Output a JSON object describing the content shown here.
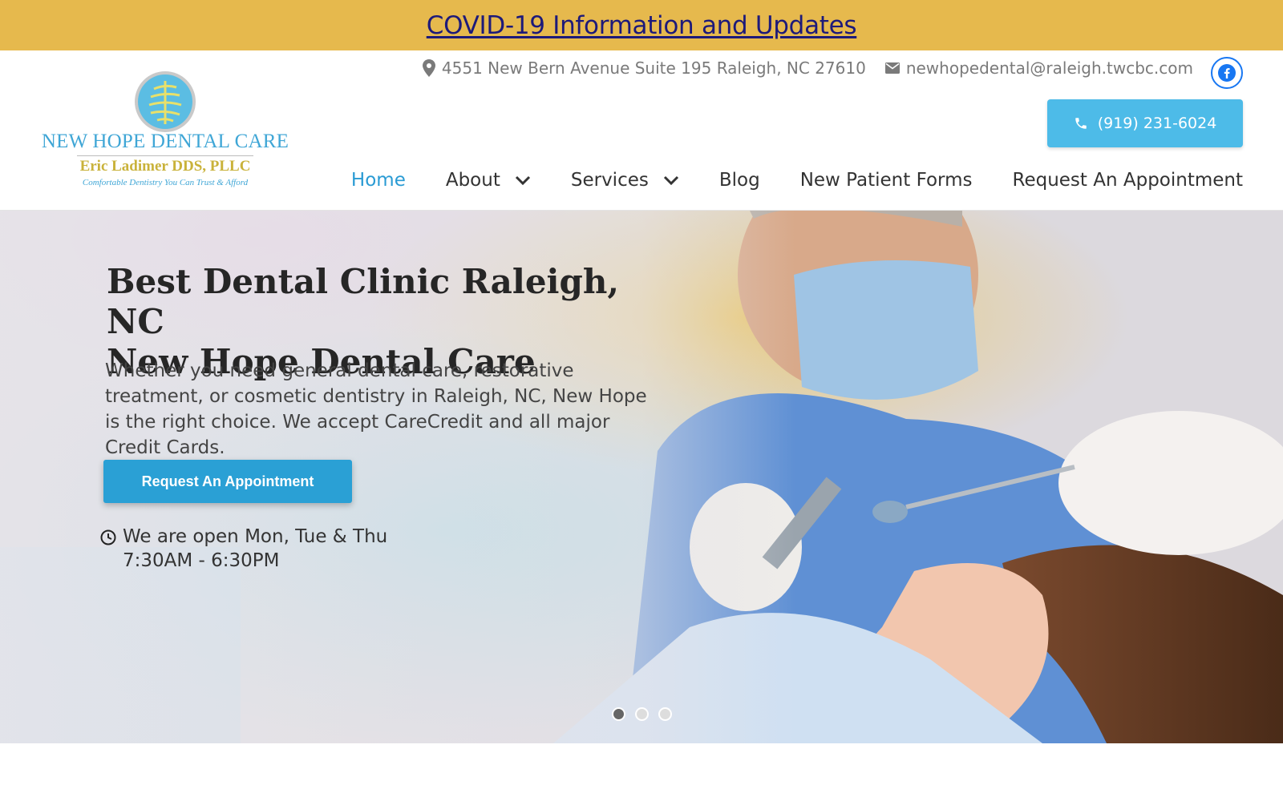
{
  "covid_banner": {
    "text": "COVID-19 Information and Updates",
    "bg_color": "#e6b94d",
    "link_color": "#1d1a7a"
  },
  "logo": {
    "title": "NEW HOPE DENTAL CARE",
    "subtitle": "Eric Ladimer DDS, PLLC",
    "tagline": "Comfortable Dentistry You Can Trust & Afford",
    "icon": "tree-emblem-icon"
  },
  "contact": {
    "address": "4551 New Bern Avenue Suite 195 Raleigh, NC 27610",
    "address_icon": "map-pin-icon",
    "email": "newhopedental@raleigh.twcbc.com",
    "email_icon": "envelope-icon",
    "social_icon": "facebook-icon",
    "phone": "(919) 231-6024",
    "phone_icon": "phone-icon"
  },
  "nav": {
    "items": [
      {
        "label": "Home",
        "active": true,
        "dropdown": false
      },
      {
        "label": "About",
        "active": false,
        "dropdown": true
      },
      {
        "label": "Services",
        "active": false,
        "dropdown": true
      },
      {
        "label": "Blog",
        "active": false,
        "dropdown": false
      },
      {
        "label": "New Patient Forms",
        "active": false,
        "dropdown": false
      },
      {
        "label": "Request An Appointment",
        "active": false,
        "dropdown": false
      }
    ],
    "active_color": "#2a9bd4"
  },
  "hero": {
    "title_line1": "Best Dental Clinic Raleigh, NC",
    "title_line2": "New Hope Dental Care",
    "description": "Whether you need general dental care, restorative treatment, or cosmetic dentistry in Raleigh, NC, New Hope is the right choice. We accept CareCredit and all major Credit Cards.",
    "cta_label": "Request An Appointment",
    "hours_line1": "We are open Mon, Tue & Thu",
    "hours_line2": "7:30AM - 6:30PM",
    "hours_icon": "clock-icon",
    "slides": 3,
    "active_slide": 1
  },
  "colors": {
    "phone_button": "#4dbbe8",
    "cta_button": "#2aa0d5"
  }
}
